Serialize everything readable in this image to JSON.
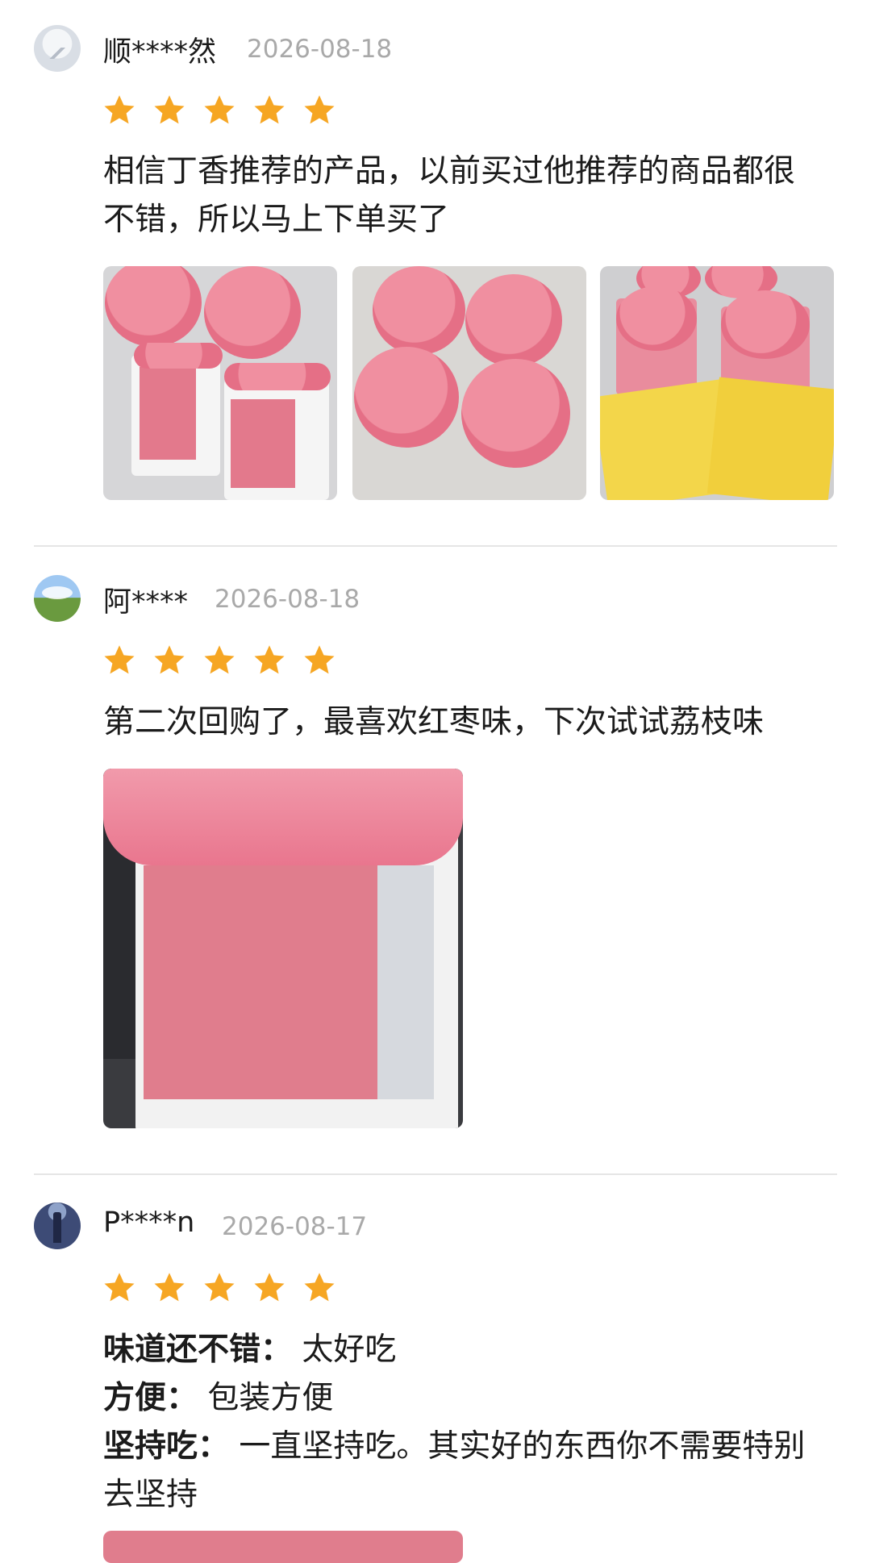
{
  "reviews": [
    {
      "username": "顺****然",
      "date": "2026-08-18",
      "rating": 5,
      "text_lines": [
        "相信丁香推荐的产品，以前买过他推荐的商品都很",
        "不错，所以马上下单买了"
      ]
    },
    {
      "username": "阿****",
      "date": "2026-08-18",
      "rating": 5,
      "text_lines": [
        "第二次回购了，最喜欢红枣味，下次试试荔枝味"
      ]
    },
    {
      "username": "P****n",
      "date": "2026-08-17",
      "rating": 5,
      "attributes": [
        {
          "key": "味道还不错：",
          "value": "太好吃"
        },
        {
          "key": "方便：",
          "value": "包装方便"
        },
        {
          "key": "坚持吃：",
          "value": "一直坚持吃。其实好的东西你不需要特别"
        }
      ],
      "continuation": "去坚持"
    }
  ],
  "icons": {
    "star": "star-icon"
  },
  "colors": {
    "star": "#f6a623",
    "date": "#a9a9a9",
    "divider": "#e5e5e5"
  }
}
